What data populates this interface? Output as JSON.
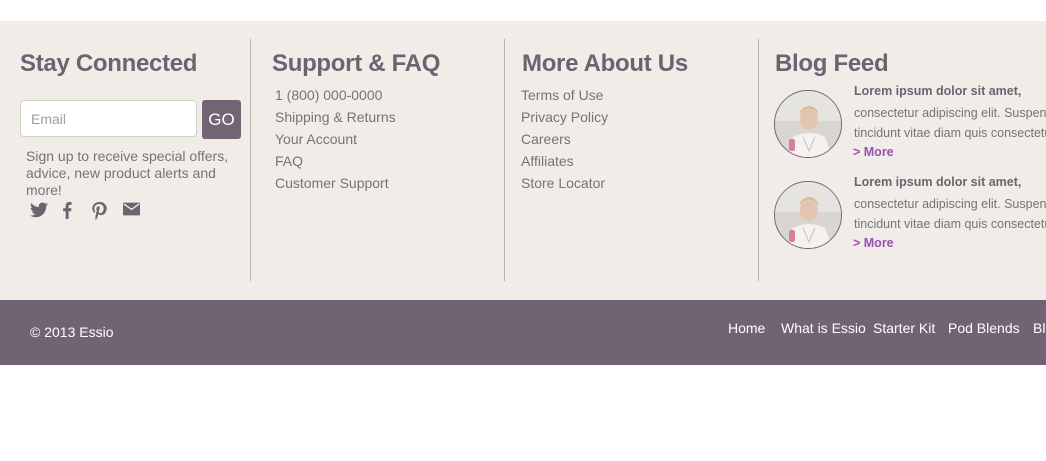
{
  "stay_connected": {
    "title": "Stay Connected",
    "email_placeholder": "Email",
    "go_label": "GO",
    "signup_text": "Sign up to receive special offers, advice, new product alerts and more!",
    "social_icons": [
      "twitter-icon",
      "facebook-icon",
      "pinterest-icon",
      "email-icon"
    ]
  },
  "support": {
    "title": "Support & FAQ",
    "items": [
      "1 (800) 000-0000",
      "Shipping & Returns",
      "Your Account",
      "FAQ",
      "Customer Support"
    ]
  },
  "about": {
    "title": "More About Us",
    "items": [
      "Terms of Use",
      "Privacy Policy",
      "Careers",
      "Affiliates",
      "Store Locator"
    ]
  },
  "blog": {
    "title": "Blog Feed",
    "posts": [
      {
        "title": "Lorem ipsum dolor sit amet,",
        "excerpt_line1": "consectetur adipiscing elit. Suspendisse",
        "excerpt_line2": "tincidunt vitae diam quis consectetur.",
        "more": "> More"
      },
      {
        "title": "Lorem ipsum dolor sit amet,",
        "excerpt_line1": "consectetur adipiscing elit. Suspendisse",
        "excerpt_line2": "tincidunt vitae diam quis consectetur.",
        "more": "> More"
      }
    ]
  },
  "bottom_bar": {
    "copyright": "© 2013 Essio",
    "nav": [
      "Home",
      "What is Essio",
      "Starter Kit",
      "Pod Blends",
      "Blog"
    ]
  },
  "colors": {
    "footer_bg": "#f0ede8",
    "bar_bg": "#716373",
    "heading": "#6e6270",
    "link_accent": "#9b4fb1"
  }
}
